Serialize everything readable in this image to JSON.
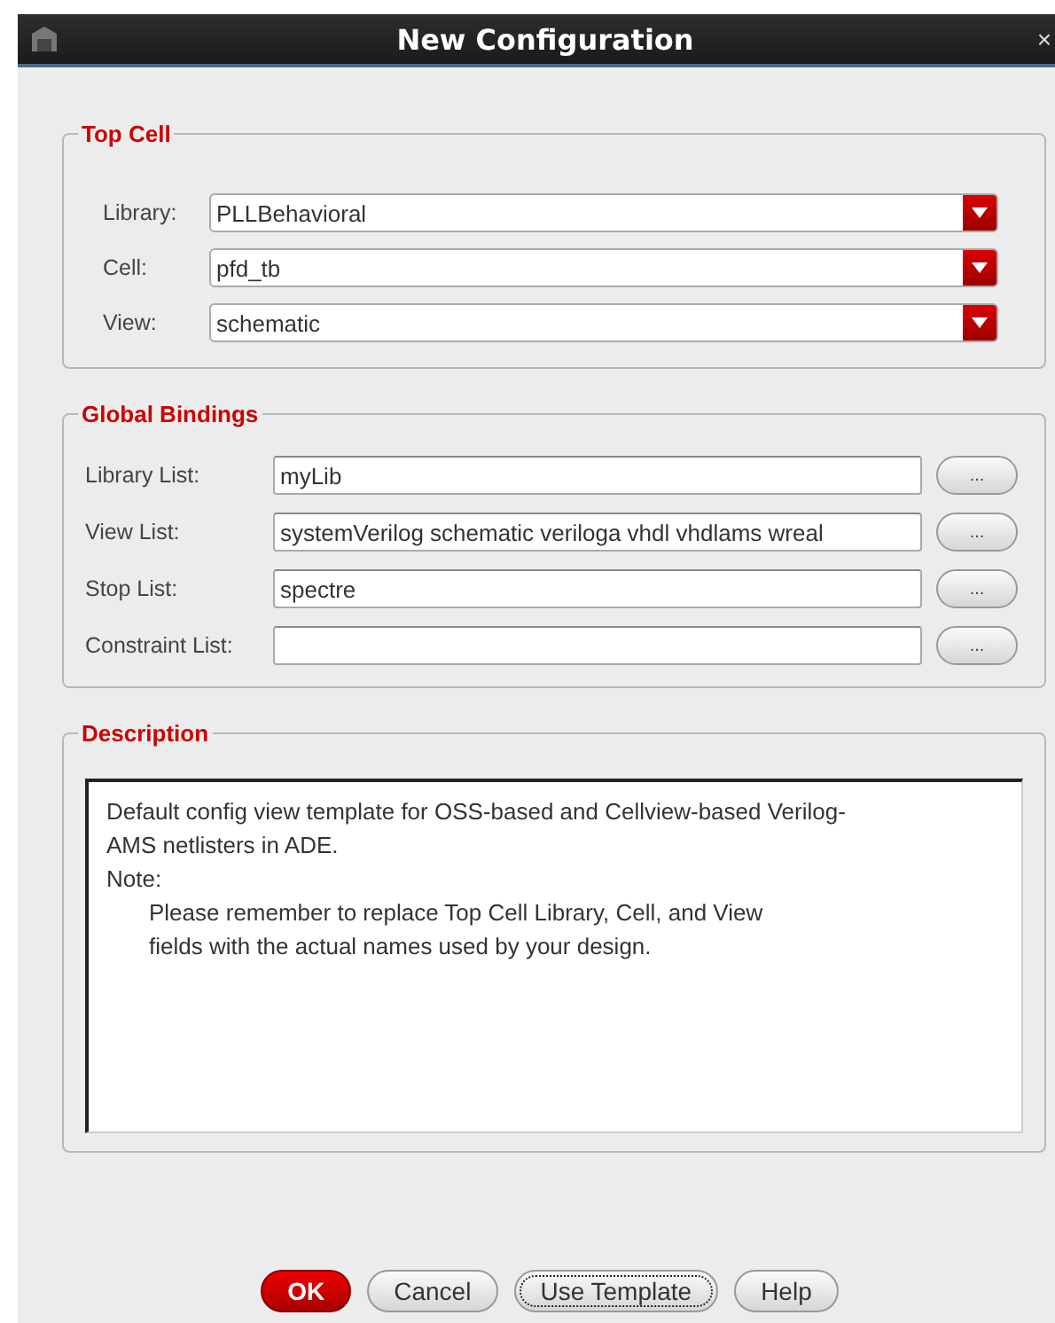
{
  "window": {
    "title": "New Configuration",
    "close": "×"
  },
  "top_cell": {
    "title": "Top Cell",
    "fields": [
      {
        "label": "Library:",
        "value": "PLLBehavioral"
      },
      {
        "label": "Cell:",
        "value": "pfd_tb"
      },
      {
        "label": "View:",
        "value": "schematic"
      }
    ]
  },
  "global_bindings": {
    "title": "Global Bindings",
    "fields": [
      {
        "label": "Library List:",
        "value": "myLib",
        "button": "..."
      },
      {
        "label": "View List:",
        "value": "systemVerilog schematic veriloga vhdl vhdlams wreal",
        "button": "..."
      },
      {
        "label": "Stop List:",
        "value": "spectre",
        "button": "..."
      },
      {
        "label": "Constraint List:",
        "button": "..."
      }
    ]
  },
  "description": {
    "title": "Description",
    "lines": [
      {
        "text": "Default config view template for OSS-based and Cellview-based Verilog-",
        "indented": false
      },
      {
        "text": "AMS netlisters in ADE.",
        "indented": false
      },
      {
        "text": "Note:",
        "indented": false
      },
      {
        "text": "Please remember to replace Top Cell Library, Cell, and View",
        "indented": true
      },
      {
        "text": "fields with the actual names used by your design.",
        "indented": true
      }
    ]
  },
  "buttons": [
    {
      "label": "OK",
      "kind": "default",
      "focused": false
    },
    {
      "label": "Cancel",
      "kind": "normal",
      "focused": false
    },
    {
      "label": "Use Template",
      "kind": "normal",
      "focused": true
    },
    {
      "label": "Help",
      "kind": "normal",
      "focused": false
    }
  ]
}
